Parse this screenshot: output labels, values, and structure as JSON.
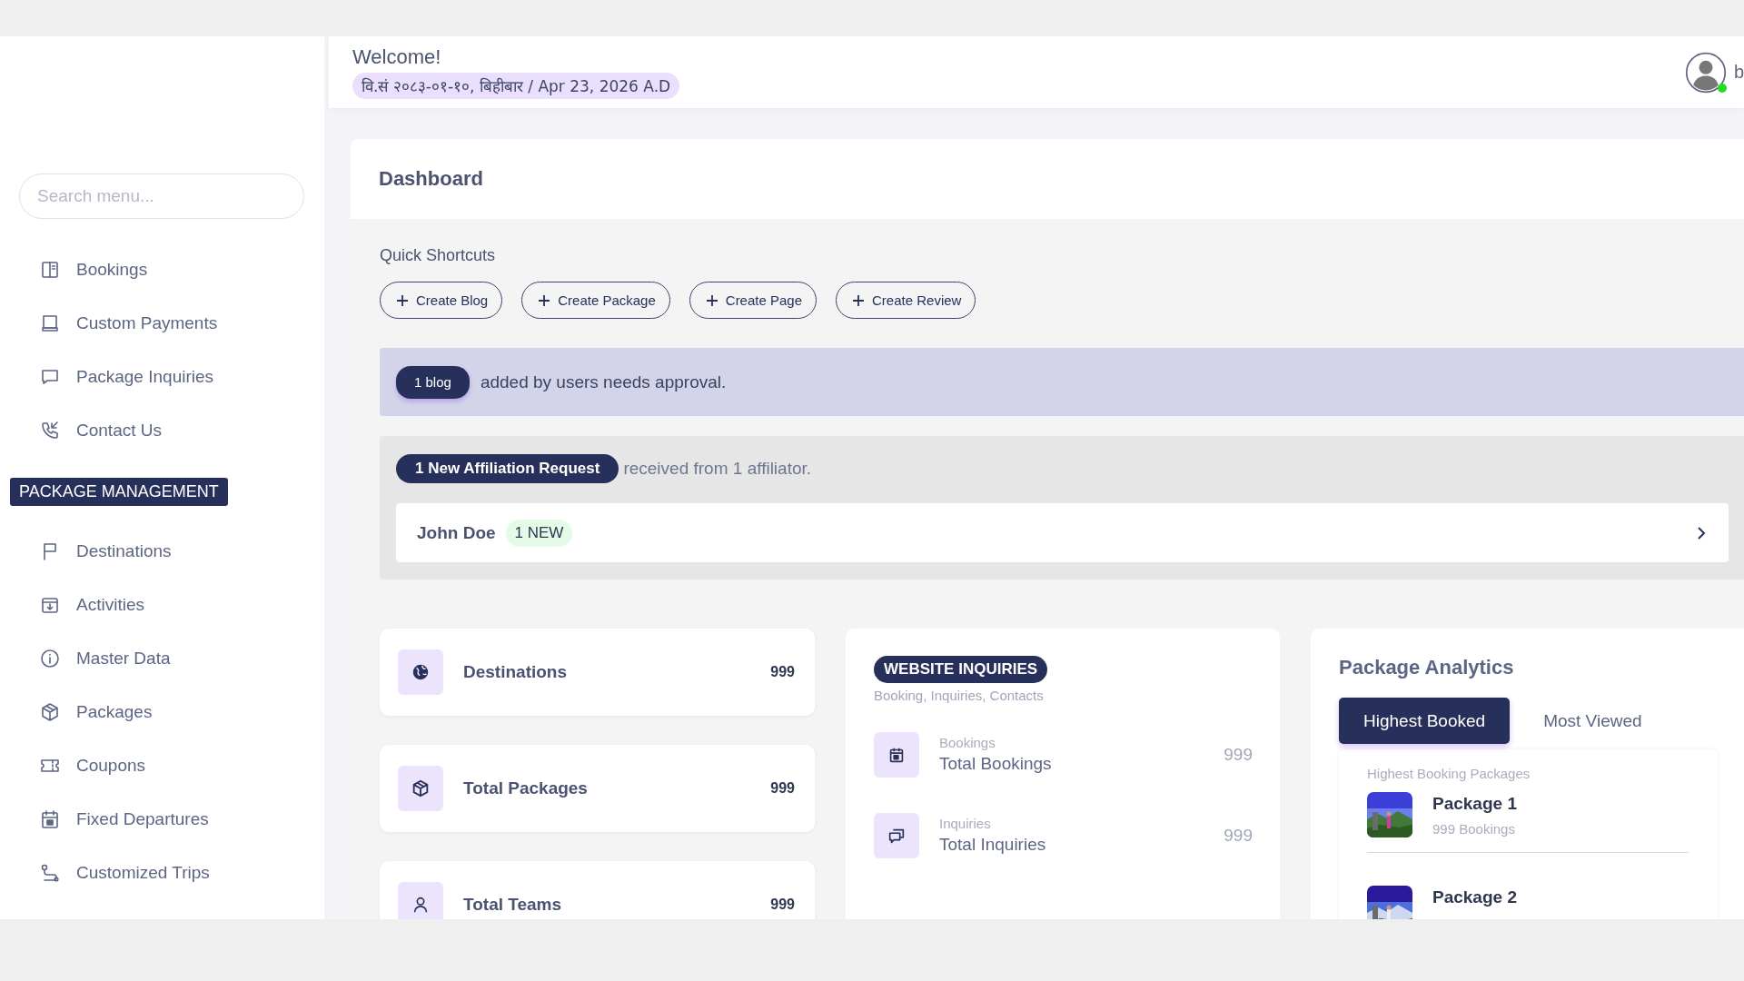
{
  "header": {
    "greeting": "Welcome!",
    "date": "वि.सं २०८३-०१-१०, बिहीबार / Apr 23, 2026 A.D",
    "online": true,
    "user_name": "b"
  },
  "sidebar": {
    "search": {
      "placeholder": "Search menu..."
    },
    "items": [
      {
        "kind": "link",
        "label": "Bookings"
      },
      {
        "kind": "link",
        "label": "Custom Payments"
      },
      {
        "kind": "link",
        "label": "Package Inquiries"
      },
      {
        "kind": "link",
        "label": "Contact Us"
      },
      {
        "kind": "section",
        "label": "PACKAGE MANAGEMENT"
      },
      {
        "kind": "link",
        "label": "Destinations"
      },
      {
        "kind": "link",
        "label": "Activities"
      },
      {
        "kind": "link",
        "label": "Master Data"
      },
      {
        "kind": "link",
        "label": "Packages"
      },
      {
        "kind": "link",
        "label": "Coupons"
      },
      {
        "kind": "link",
        "label": "Fixed Departures"
      },
      {
        "kind": "link",
        "label": "Customized Trips"
      }
    ]
  },
  "dashboard": {
    "title": "Dashboard",
    "shortcuts_title": "Quick Shortcuts",
    "shortcuts": [
      "Create Blog",
      "Create Package",
      "Create Page",
      "Create Review"
    ],
    "blog_alert": {
      "badge": "1 blog",
      "text": "added by users needs approval."
    },
    "affiliation": {
      "badge": "1 New Affiliation Request",
      "text": "received from 1 affiliator.",
      "requests": [
        {
          "name": "John Doe",
          "badge": "1 NEW"
        }
      ]
    },
    "stats": [
      {
        "label": "Destinations",
        "value": "999"
      },
      {
        "label": "Total Packages",
        "value": "999"
      },
      {
        "label": "Total Teams",
        "value": "999"
      }
    ],
    "inquiries": {
      "badge": "WEBSITE INQUIRIES",
      "subtitle": "Booking, Inquiries, Contacts",
      "items": [
        {
          "category": "Bookings",
          "label": "Total Bookings",
          "value": "999"
        },
        {
          "category": "Inquiries",
          "label": "Total Inquiries",
          "value": "999"
        }
      ]
    },
    "analytics": {
      "title": "Package Analytics",
      "tabs": [
        {
          "label": "Highest Booked",
          "selected": true
        },
        {
          "label": "Most Viewed",
          "selected": false
        }
      ],
      "list_title": "Highest Booking Packages",
      "packages": [
        {
          "name": "Package 1",
          "bookings": "999 Bookings"
        },
        {
          "name": "Package 2"
        }
      ]
    }
  }
}
